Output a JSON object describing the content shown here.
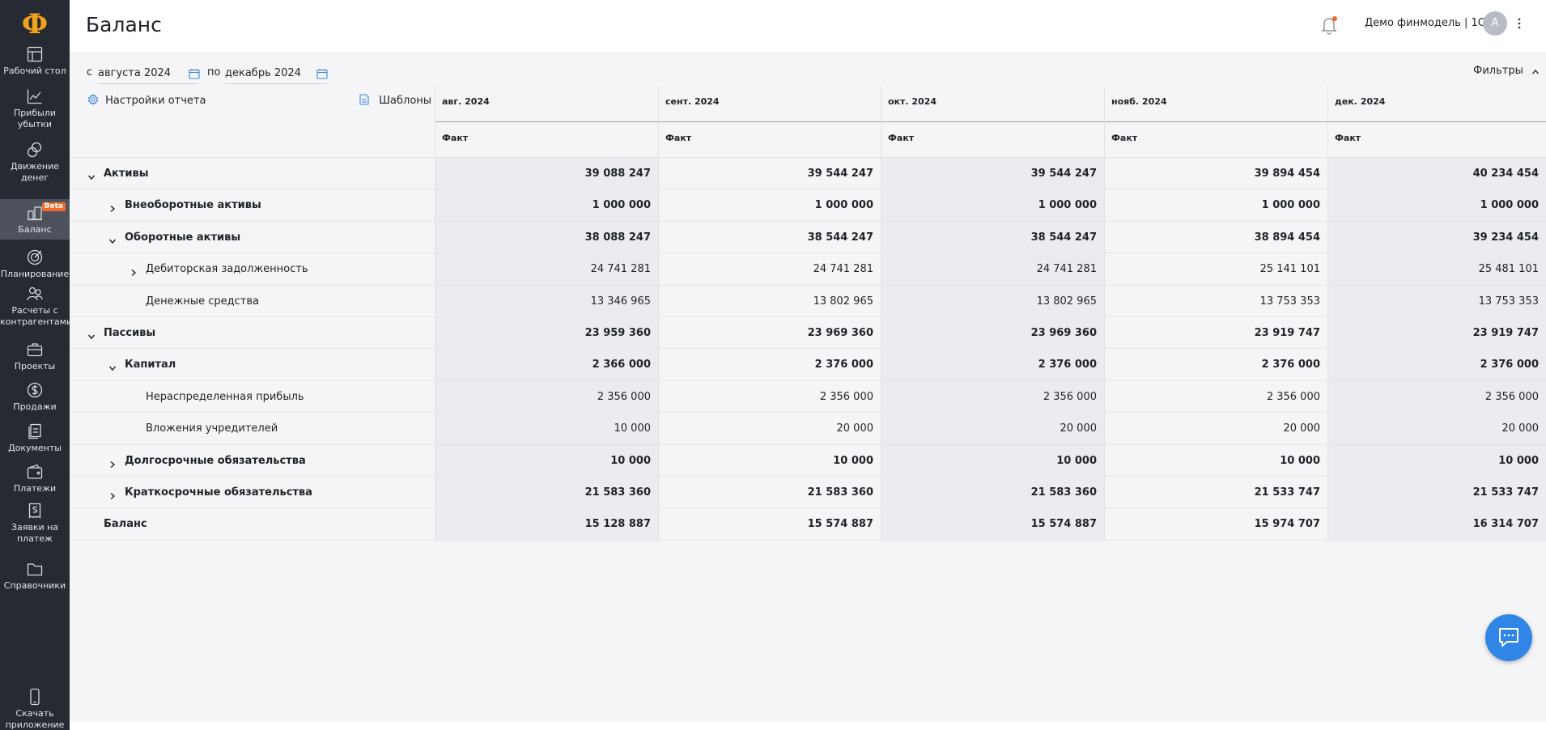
{
  "sidebar": {
    "logo": "Ф",
    "items": [
      {
        "key": "dashboard",
        "label": "Рабочий стол",
        "icon": "dashboard-icon"
      },
      {
        "key": "pnl",
        "label": "Прибыли убытки",
        "icon": "chart-icon"
      },
      {
        "key": "cashflow",
        "label": "Движение денег",
        "icon": "coins-icon"
      },
      {
        "key": "balance",
        "label": "Баланс",
        "icon": "balance-icon",
        "badge": "Beta",
        "active": true
      },
      {
        "key": "planning",
        "label": "Планирование",
        "icon": "target-icon"
      },
      {
        "key": "counterparties",
        "label": "Расчеты с контрагентами",
        "icon": "handshake-icon"
      },
      {
        "key": "projects",
        "label": "Проекты",
        "icon": "briefcase-icon"
      },
      {
        "key": "sales",
        "label": "Продажи",
        "icon": "dollar-icon"
      },
      {
        "key": "documents",
        "label": "Документы",
        "icon": "documents-icon"
      },
      {
        "key": "payments",
        "label": "Платежи",
        "icon": "wallet-icon"
      },
      {
        "key": "requests",
        "label": "Заявки на платеж",
        "icon": "invoice-icon"
      },
      {
        "key": "references",
        "label": "Справочники",
        "icon": "folder-icon"
      }
    ],
    "download": {
      "label": "Скачать приложение",
      "icon": "phone-icon"
    }
  },
  "header": {
    "title": "Баланс",
    "account_name": "Демо финмодель | 1С",
    "avatar_letter": "А"
  },
  "filters_bar": {
    "from_label": "с",
    "from_value": "августа 2024",
    "to_label": "по",
    "to_value": "декабрь 2024",
    "filters_label": "Фильтры"
  },
  "table": {
    "settings_label": "Настройки отчета",
    "templates_label": "Шаблоны",
    "columns": [
      {
        "month": "авг. 2024",
        "sub": "Факт"
      },
      {
        "month": "сент. 2024",
        "sub": "Факт"
      },
      {
        "month": "окт. 2024",
        "sub": "Факт"
      },
      {
        "month": "нояб. 2024",
        "sub": "Факт"
      },
      {
        "month": "дек. 2024",
        "sub": "Факт"
      }
    ],
    "rows": [
      {
        "label": "Активы",
        "level": 0,
        "caret": "down",
        "bold": true,
        "values": [
          "39 088 247",
          "39 544 247",
          "39 544 247",
          "39 894 454",
          "40 234 454"
        ]
      },
      {
        "label": "Внеоборотные активы",
        "level": 1,
        "caret": "right",
        "bold": true,
        "values": [
          "1 000 000",
          "1 000 000",
          "1 000 000",
          "1 000 000",
          "1 000 000"
        ]
      },
      {
        "label": "Оборотные активы",
        "level": 1,
        "caret": "down",
        "bold": true,
        "values": [
          "38 088 247",
          "38 544 247",
          "38 544 247",
          "38 894 454",
          "39 234 454"
        ]
      },
      {
        "label": "Дебиторская задолженность",
        "level": 2,
        "caret": "right",
        "bold": false,
        "values": [
          "24 741 281",
          "24 741 281",
          "24 741 281",
          "25 141 101",
          "25 481 101"
        ]
      },
      {
        "label": "Денежные средства",
        "level": 2,
        "caret": "none",
        "bold": false,
        "values": [
          "13 346 965",
          "13 802 965",
          "13 802 965",
          "13 753 353",
          "13 753 353"
        ]
      },
      {
        "label": "Пассивы",
        "level": 0,
        "caret": "down",
        "bold": true,
        "values": [
          "23 959 360",
          "23 969 360",
          "23 969 360",
          "23 919 747",
          "23 919 747"
        ]
      },
      {
        "label": "Капитал",
        "level": 1,
        "caret": "down",
        "bold": true,
        "values": [
          "2 366 000",
          "2 376 000",
          "2 376 000",
          "2 376 000",
          "2 376 000"
        ]
      },
      {
        "label": "Нераспределенная прибыль",
        "level": 2,
        "caret": "none",
        "bold": false,
        "values": [
          "2 356 000",
          "2 356 000",
          "2 356 000",
          "2 356 000",
          "2 356 000"
        ]
      },
      {
        "label": "Вложения учредителей",
        "level": 2,
        "caret": "none",
        "bold": false,
        "values": [
          "10 000",
          "20 000",
          "20 000",
          "20 000",
          "20 000"
        ]
      },
      {
        "label": "Долгосрочные обязательства",
        "level": 1,
        "caret": "right",
        "bold": true,
        "values": [
          "10 000",
          "10 000",
          "10 000",
          "10 000",
          "10 000"
        ]
      },
      {
        "label": "Краткосрочные обязательства",
        "level": 1,
        "caret": "right",
        "bold": true,
        "values": [
          "21 583 360",
          "21 583 360",
          "21 583 360",
          "21 533 747",
          "21 533 747"
        ]
      },
      {
        "label": "Баланс",
        "level": 0,
        "caret": "none",
        "bold": true,
        "values": [
          "15 128 887",
          "15 574 887",
          "15 574 887",
          "15 974 707",
          "16 314 707"
        ]
      }
    ]
  },
  "colors": {
    "sidebar_bg": "#262a33",
    "sidebar_active": "#4d525c",
    "logo": "#f2a21b",
    "beta_badge": "#f26b2a",
    "chat_button": "#2f86e6",
    "content_bg": "#f5f5f7"
  }
}
